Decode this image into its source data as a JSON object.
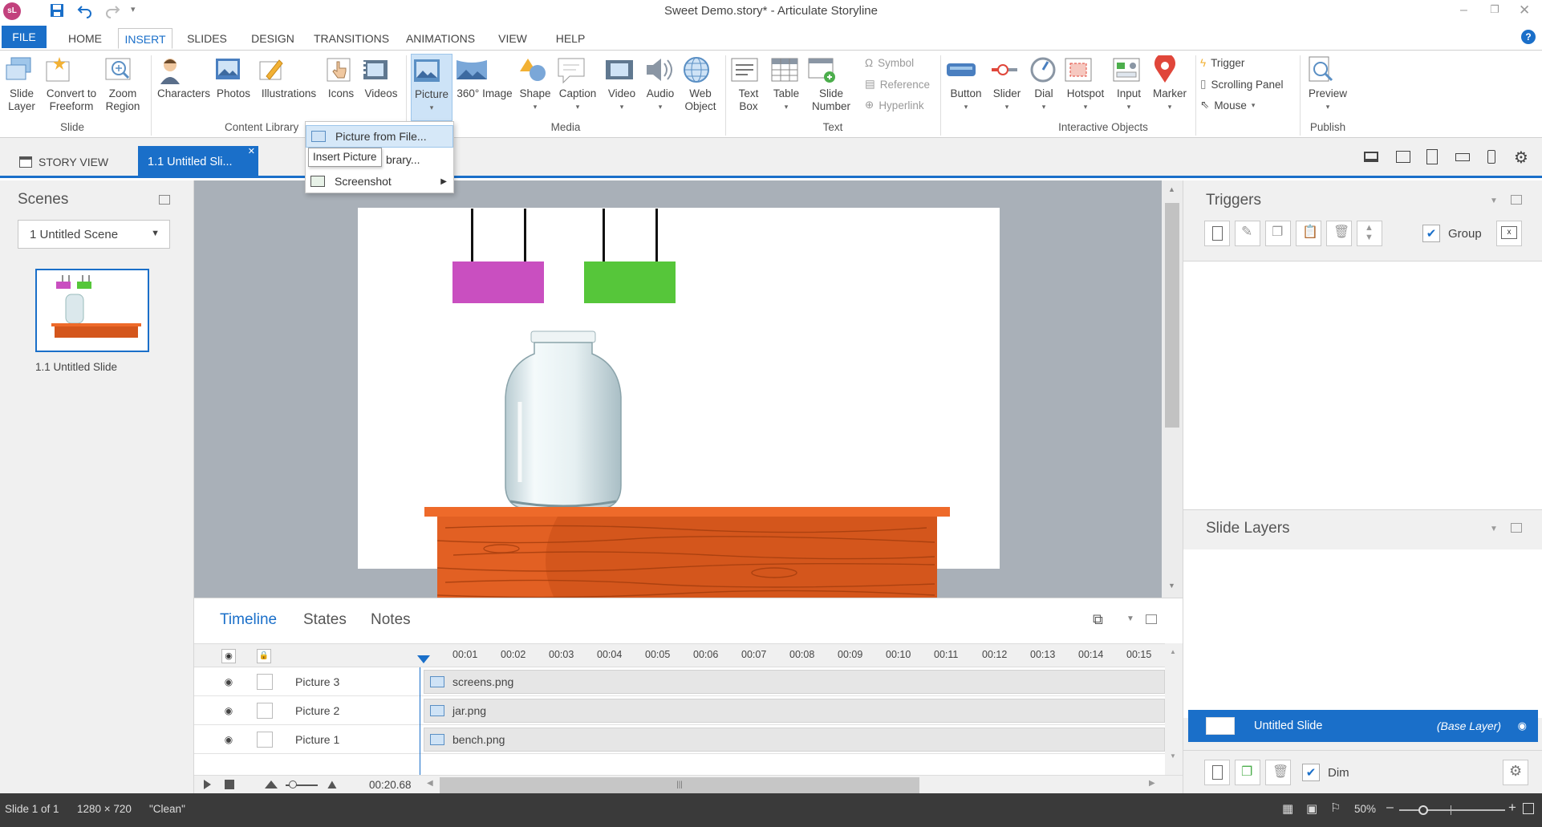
{
  "app": {
    "logo": "sL",
    "title": "Sweet Demo.story* - Articulate Storyline"
  },
  "menu": {
    "tabs": [
      "FILE",
      "HOME",
      "INSERT",
      "SLIDES",
      "DESIGN",
      "TRANSITIONS",
      "ANIMATIONS",
      "VIEW",
      "HELP"
    ],
    "active": "INSERT"
  },
  "ribbon": {
    "slide_group": {
      "label": "Slide",
      "buttons": [
        "Slide\nLayer",
        "Convert to\nFreeform",
        "Zoom\nRegion"
      ]
    },
    "content_group": {
      "label": "Content Library",
      "buttons": [
        "Characters",
        "Photos",
        "Illustrations",
        "Icons",
        "Videos"
      ]
    },
    "media_group": {
      "label": "Media",
      "buttons": [
        "Picture",
        "360° Image",
        "Shape",
        "Caption",
        "Video",
        "Audio",
        "Web\nObject"
      ]
    },
    "text_group": {
      "label": "Text",
      "buttons": [
        "Text\nBox",
        "Table",
        "Slide\nNumber"
      ],
      "small": [
        "Symbol",
        "Reference",
        "Hyperlink"
      ]
    },
    "interactive_group": {
      "label": "Interactive Objects",
      "buttons": [
        "Button",
        "Slider",
        "Dial",
        "Hotspot",
        "Input",
        "Marker"
      ]
    },
    "trigger_group": {
      "small": [
        "Trigger",
        "Scrolling Panel",
        "Mouse"
      ]
    },
    "publish_group": {
      "label": "Publish",
      "buttons": [
        "Preview"
      ]
    }
  },
  "picture_menu": {
    "items": [
      "Picture from File...",
      "Picture from Library...",
      "Screenshot"
    ],
    "tooltip": "Insert Picture",
    "visible_library_text": "brary..."
  },
  "tabs": {
    "story_view": "STORY VIEW",
    "slide_tab": "1.1 Untitled Sli..."
  },
  "scenes": {
    "title": "Scenes",
    "selected_scene": "1 Untitled Scene",
    "slide_caption": "1.1 Untitled Slide"
  },
  "timeline": {
    "tabs": [
      "Timeline",
      "States",
      "Notes"
    ],
    "active_tab": "Timeline",
    "ticks": [
      "00:01",
      "00:02",
      "00:03",
      "00:04",
      "00:05",
      "00:06",
      "00:07",
      "00:08",
      "00:09",
      "00:10",
      "00:11",
      "00:12",
      "00:13",
      "00:14",
      "00:15"
    ],
    "rows": [
      {
        "name": "Picture 3",
        "file": "screens.png"
      },
      {
        "name": "Picture 2",
        "file": "jar.png"
      },
      {
        "name": "Picture 1",
        "file": "bench.png"
      }
    ],
    "duration": "00:20.68"
  },
  "triggers": {
    "title": "Triggers",
    "group_label": "Group",
    "group_checked": true
  },
  "slide_layers": {
    "title": "Slide Layers",
    "base_name": "Untitled Slide",
    "base_tag": "(Base Layer)",
    "dim_label": "Dim",
    "dim_checked": true
  },
  "status": {
    "slide": "Slide 1 of 1",
    "size": "1280 × 720",
    "theme": "\"Clean\"",
    "zoom": "50%"
  },
  "colors": {
    "accent": "#1a6fc9",
    "magenta_box": "#c94fc0",
    "green_box": "#56c63a",
    "bench_top": "#ee6a2a",
    "bench_body": "#d4561c"
  }
}
